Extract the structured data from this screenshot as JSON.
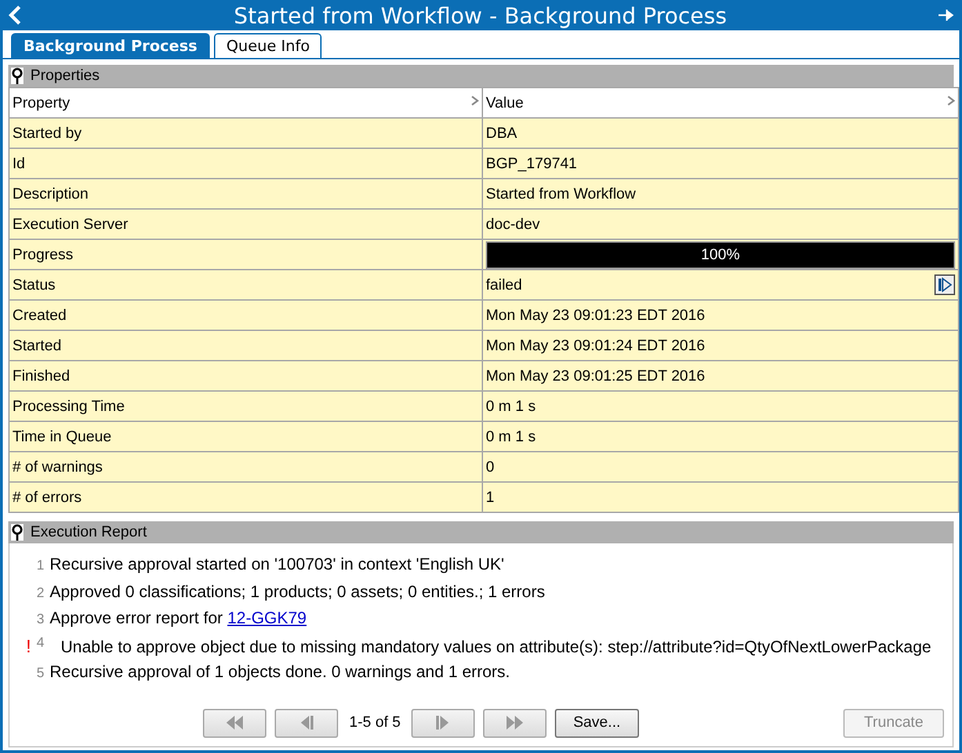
{
  "window": {
    "title": "Started from Workflow - Background Process"
  },
  "tabs": [
    {
      "label": "Background Process",
      "selected": true
    },
    {
      "label": "Queue Info",
      "selected": false
    }
  ],
  "properties": {
    "title": "Properties",
    "columns": [
      "Property",
      "Value"
    ],
    "rows": [
      {
        "kind": "text",
        "name": "Started by",
        "value": "DBA"
      },
      {
        "kind": "text",
        "name": "Id",
        "value": "BGP_179741"
      },
      {
        "kind": "text",
        "name": "Description",
        "value": "Started from Workflow"
      },
      {
        "kind": "text",
        "name": "Execution Server",
        "value": "doc-dev"
      },
      {
        "kind": "progress",
        "name": "Progress",
        "value": "100%",
        "level": 1
      },
      {
        "kind": "action",
        "name": "Status",
        "value": "failed"
      },
      {
        "kind": "text",
        "name": "Created",
        "value": "Mon May 23 09:01:23 EDT 2016"
      },
      {
        "kind": "text",
        "name": "Started",
        "value": "Mon May 23 09:01:24 EDT 2016"
      },
      {
        "kind": "text",
        "name": "Finished",
        "value": "Mon May 23 09:01:25 EDT 2016"
      },
      {
        "kind": "text",
        "name": "Processing Time",
        "value": "0 m 1 s"
      },
      {
        "kind": "text",
        "name": "Time in Queue",
        "value": "0 m 1 s"
      },
      {
        "kind": "text",
        "name": "# of warnings",
        "value": "0"
      },
      {
        "kind": "text",
        "name": "# of errors",
        "value": "1"
      }
    ]
  },
  "report": {
    "title": "Execution Report",
    "lines": [
      {
        "number": "1",
        "text": "Recursive approval started on '100703' in context 'English UK'",
        "error": false
      },
      {
        "number": "2",
        "text": "Approved 0 classifications; 1 products; 0 assets; 0 entities.; 1 errors",
        "error": false
      },
      {
        "number": "3",
        "text": "Approve error report for",
        "link": "12-GGK79",
        "error": false
      },
      {
        "number": "4",
        "text": "Unable to approve object due to missing mandatory values on attribute(s): step://attribute?id=QtyOfNextLowerPackage",
        "error": true,
        "marker": "!"
      },
      {
        "number": "5",
        "text": "Recursive approval of 1 objects done. 0 warnings and 1 errors.",
        "error": false
      }
    ],
    "pager": {
      "first": {
        "disabled": true
      },
      "previous": {
        "disabled": true
      },
      "range": "1-5 of 5",
      "next": {
        "disabled": true
      },
      "last": {
        "disabled": true
      }
    },
    "buttons": [
      {
        "label": "Save...",
        "disabled": false
      },
      {
        "label": "Truncate",
        "disabled": true
      }
    ]
  }
}
